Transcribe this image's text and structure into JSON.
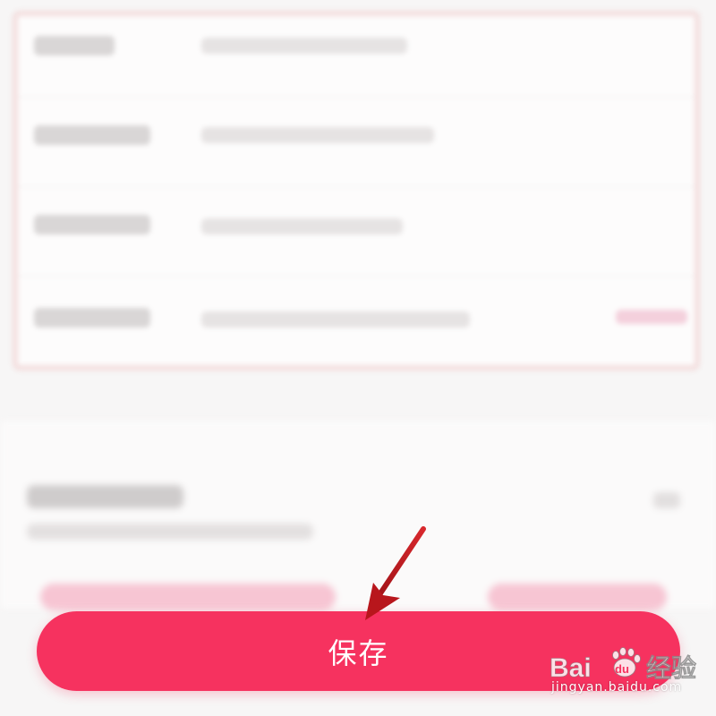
{
  "save_button": {
    "label": "保存"
  },
  "watermark": {
    "brand": "Bai du 经验",
    "url": "jingyan.baidu.com"
  },
  "colors": {
    "accent": "#f6325f",
    "arrow": "#c0191f"
  },
  "icons": {
    "pointer": "arrow-icon",
    "logo": "baidu-paw-icon"
  }
}
